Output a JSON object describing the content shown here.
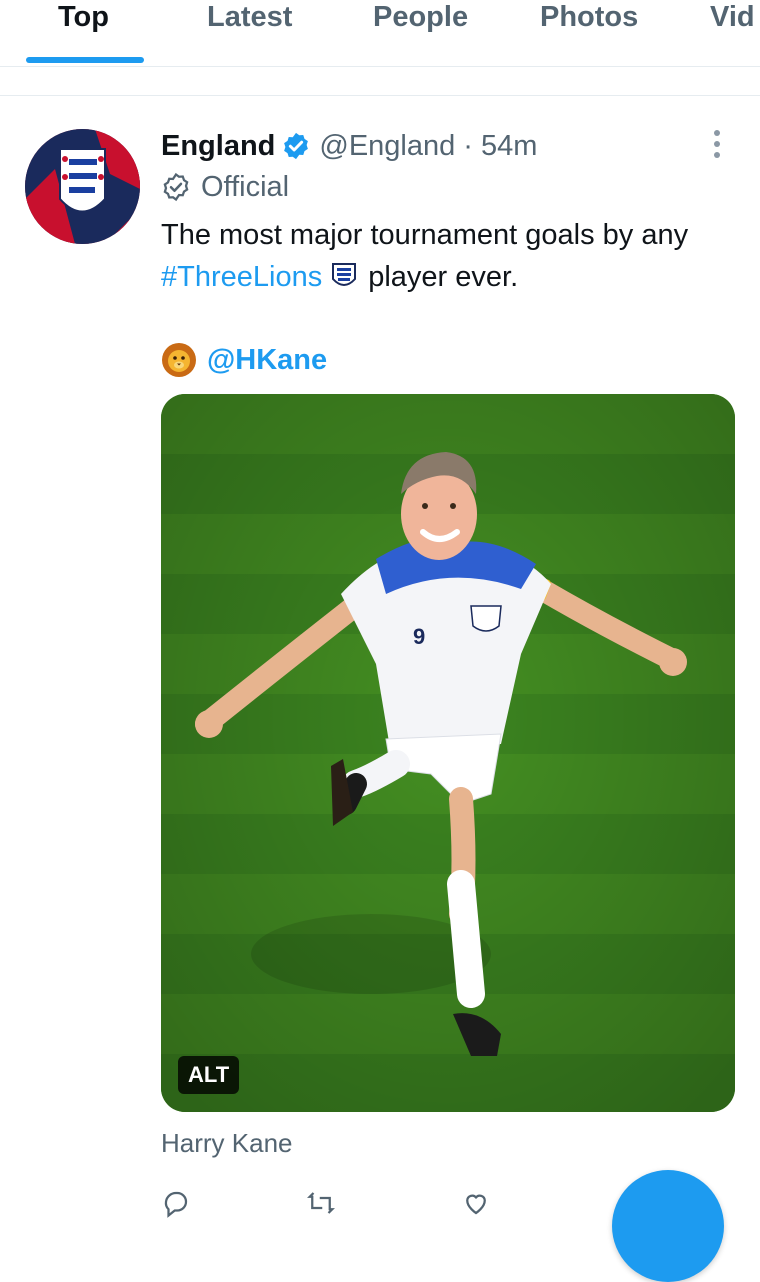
{
  "tabs": [
    {
      "label": "Top",
      "active": true
    },
    {
      "label": "Latest",
      "active": false
    },
    {
      "label": "People",
      "active": false
    },
    {
      "label": "Photos",
      "active": false
    },
    {
      "label": "Vid",
      "active": false
    }
  ],
  "tweet": {
    "author_name": "England",
    "handle": "@England",
    "separator": "·",
    "time": "54m",
    "label": "Official",
    "text_line1": "The most major tournament goals by any",
    "hashtag": "#ThreeLions",
    "text_line2_rest": "player ever.",
    "mention": "@HKane",
    "alt_badge": "ALT",
    "media_caption": "Harry Kane"
  },
  "colors": {
    "accent": "#1d9bf0",
    "text_primary": "#0f1419",
    "text_secondary": "#536471",
    "pitch_green": "#3f8a1e"
  }
}
